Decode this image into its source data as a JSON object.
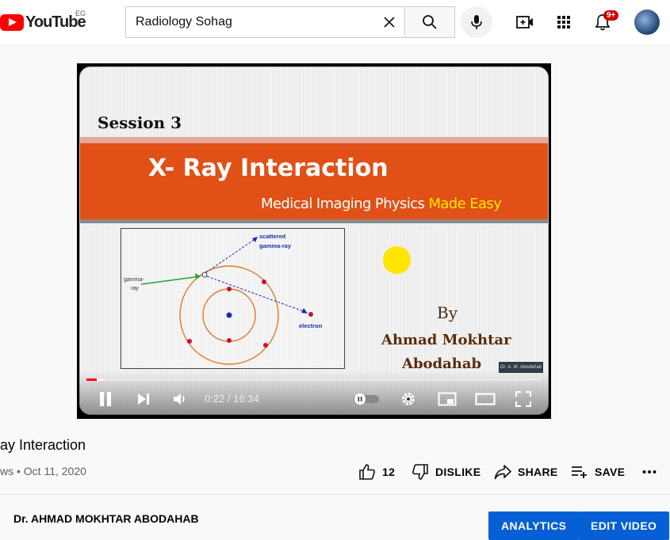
{
  "header": {
    "logo_text": "YouTube",
    "country_code": "EG",
    "search_value": "Radiology Sohag",
    "notification_count": "9+"
  },
  "player": {
    "slide": {
      "session": "Session 3",
      "title": "X- Ray Interaction",
      "subtitle_plain": "Medical Imaging Physics ",
      "subtitle_highlight": "Made Easy",
      "diagram_labels": {
        "scattered": "scattered",
        "gamma_ray_out": "gamma-ray",
        "gamma_in_1": "gamma-",
        "gamma_in_2": "ray",
        "electron": "electron"
      },
      "by": "By",
      "author_line1": "Ahmad Mokhtar",
      "author_line2": "Abodahab",
      "stamp": "Dr. A. M. Abodahab"
    },
    "time_display": "0:22 / 16:34",
    "progress_played_fraction": 0.022,
    "progress_loaded_fraction": 0.04,
    "accent_color": "#ff0000"
  },
  "video": {
    "title": "ay Interaction",
    "meta": "ws • Oct 11, 2020",
    "like_count": "12",
    "dislike_label": "DISLIKE",
    "share_label": "SHARE",
    "save_label": "SAVE"
  },
  "channel": {
    "name": "Dr. AHMAD MOKHTAR ABODAHAB",
    "analytics_label": "ANALYTICS",
    "edit_video_label": "EDIT VIDEO"
  },
  "colors": {
    "brand_red": "#ff0000",
    "primary_blue": "#065fd4",
    "slide_band": "#e05017"
  },
  "icons": [
    "youtube-logo-icon",
    "clear-icon",
    "search-icon",
    "mic-icon",
    "create-video-icon",
    "apps-grid-icon",
    "bell-icon",
    "pause-icon",
    "next-icon",
    "volume-icon",
    "autoplay-toggle-icon",
    "settings-gear-icon",
    "miniplayer-icon",
    "theater-mode-icon",
    "fullscreen-icon",
    "thumb-up-icon",
    "thumb-down-icon",
    "share-icon",
    "save-playlist-icon",
    "more-icon"
  ]
}
